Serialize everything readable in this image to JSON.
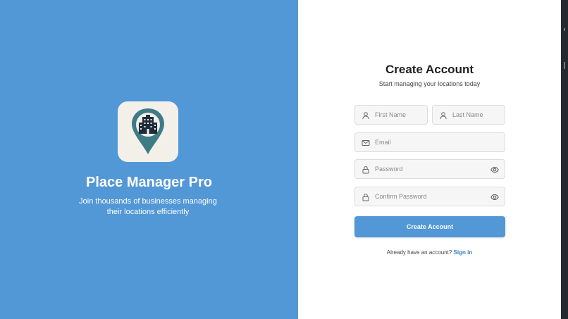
{
  "brand": {
    "title": "Place Manager Pro",
    "subtitle": "Join thousands of businesses managing their locations efficiently",
    "logo_icon": "building-pin-icon"
  },
  "form": {
    "title": "Create Account",
    "subtitle": "Start managing your locations today",
    "first_name": {
      "placeholder": "First Name",
      "icon": "user-icon"
    },
    "last_name": {
      "placeholder": "Last Name",
      "icon": "user-icon"
    },
    "email": {
      "placeholder": "Email",
      "icon": "mail-icon"
    },
    "password": {
      "placeholder": "Password",
      "icon": "lock-icon"
    },
    "confirm_password": {
      "placeholder": "Confirm Password",
      "icon": "lock-icon"
    },
    "submit_label": "Create Account",
    "signin_prompt": "Already have an account?",
    "signin_link": "Sign in"
  },
  "colors": {
    "accent": "#5297d6",
    "link": "#3a80c4",
    "pin": "#3e7b86",
    "building": "#1f2d3a"
  }
}
